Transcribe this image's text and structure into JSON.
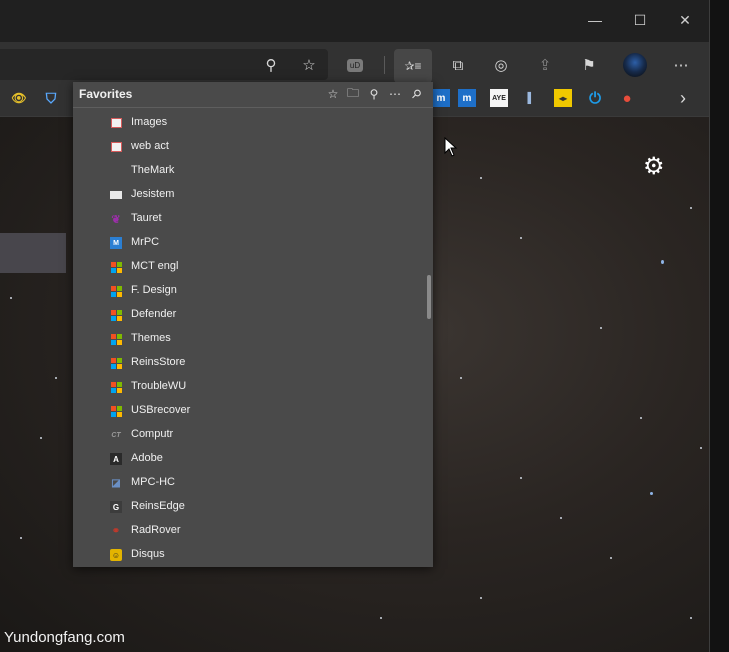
{
  "window": {
    "caption_buttons": [
      {
        "name": "minimize-button",
        "glyph": "—"
      },
      {
        "name": "maximize-button",
        "glyph": "☐"
      },
      {
        "name": "close-button",
        "glyph": "✕"
      }
    ]
  },
  "toolbar": {
    "icons": [
      {
        "name": "zoom-icon",
        "glyph": "⚲"
      },
      {
        "name": "add-favorite-star-icon",
        "glyph": "☆"
      },
      {
        "name": "ublock-origin-icon",
        "glyph": "uD"
      },
      {
        "name": "favorites-hub-icon",
        "glyph": "✰≡"
      },
      {
        "name": "collections-icon",
        "glyph": "⧉"
      },
      {
        "name": "screenshot-icon",
        "glyph": "◎"
      },
      {
        "name": "share-icon",
        "glyph": "⇪"
      },
      {
        "name": "feedback-icon",
        "glyph": "⚑"
      },
      {
        "name": "profile-avatar-icon",
        "glyph": ""
      },
      {
        "name": "more-options-icon",
        "glyph": "⋯"
      }
    ]
  },
  "favorites_bar": {
    "left_icons": [
      {
        "name": "favbar-eye-icon",
        "glyph": "👁"
      },
      {
        "name": "favbar-shield-icon",
        "glyph": "⛉"
      }
    ],
    "right_icons": [
      {
        "name": "favbar-m-icon",
        "glyph": "m",
        "color": "#1e6fc8"
      },
      {
        "name": "favbar-m2-icon",
        "glyph": "m",
        "color": "#1e6fc8"
      },
      {
        "name": "favbar-aye-icon",
        "glyph": "AYE",
        "color": "#f5f5f5"
      },
      {
        "name": "favbar-book-icon",
        "glyph": "▌",
        "color": "#5b7ea8"
      },
      {
        "name": "favbar-arrows-icon",
        "glyph": "◂▸",
        "color": "#f0c800"
      },
      {
        "name": "favbar-power-icon",
        "glyph": "⏻",
        "color": "#1e9be8"
      },
      {
        "name": "favbar-circle-icon",
        "glyph": "●",
        "color": "#e84d3b"
      }
    ],
    "overflow_glyph": "›"
  },
  "favorites_panel": {
    "title": "Favorites",
    "header_icons": [
      {
        "name": "add-page-to-favorites-icon",
        "glyph": "☆"
      },
      {
        "name": "add-folder-icon",
        "glyph": "🗀"
      },
      {
        "name": "search-favorites-icon",
        "glyph": "⚲"
      },
      {
        "name": "more-favorites-options-icon",
        "glyph": "⋯"
      },
      {
        "name": "pin-favorites-icon",
        "glyph": "⚲"
      }
    ],
    "items": [
      {
        "label": "Images",
        "icon": "image",
        "color": "#d65b5b"
      },
      {
        "label": "web act",
        "icon": "image",
        "color": "#d65b5b"
      },
      {
        "label": "TheMark",
        "icon": "none",
        "color": ""
      },
      {
        "label": "Jesistem",
        "icon": "box",
        "color": "#e8e8e8"
      },
      {
        "label": "Tauret",
        "icon": "bird",
        "color": "#9b2fa8"
      },
      {
        "label": "MrPC",
        "icon": "mrpc",
        "color": "#2b7fd3"
      },
      {
        "label": "MCT engl",
        "icon": "ms",
        "color": ""
      },
      {
        "label": "F. Design",
        "icon": "ms",
        "color": ""
      },
      {
        "label": "Defender",
        "icon": "ms",
        "color": ""
      },
      {
        "label": "Themes",
        "icon": "ms",
        "color": ""
      },
      {
        "label": "ReinsStore",
        "icon": "ms",
        "color": ""
      },
      {
        "label": "TroubleWU",
        "icon": "ms",
        "color": ""
      },
      {
        "label": "USBrecover",
        "icon": "ms",
        "color": ""
      },
      {
        "label": "Computr",
        "icon": "ct",
        "color": "#9a9a9a"
      },
      {
        "label": "Adobe",
        "icon": "adobe",
        "color": "#2a2a2a"
      },
      {
        "label": "MPC-HC",
        "icon": "mpc",
        "color": "#6a8fc4"
      },
      {
        "label": "ReinsEdge",
        "icon": "g",
        "color": "#3c3c3c"
      },
      {
        "label": "RadRover",
        "icon": "bike",
        "color": "#c0392b"
      },
      {
        "label": "Disqus",
        "icon": "disqus",
        "color": "#e3b400"
      }
    ]
  },
  "page": {
    "watermark": "Yundongfang.com",
    "settings_glyph": "⚙"
  }
}
